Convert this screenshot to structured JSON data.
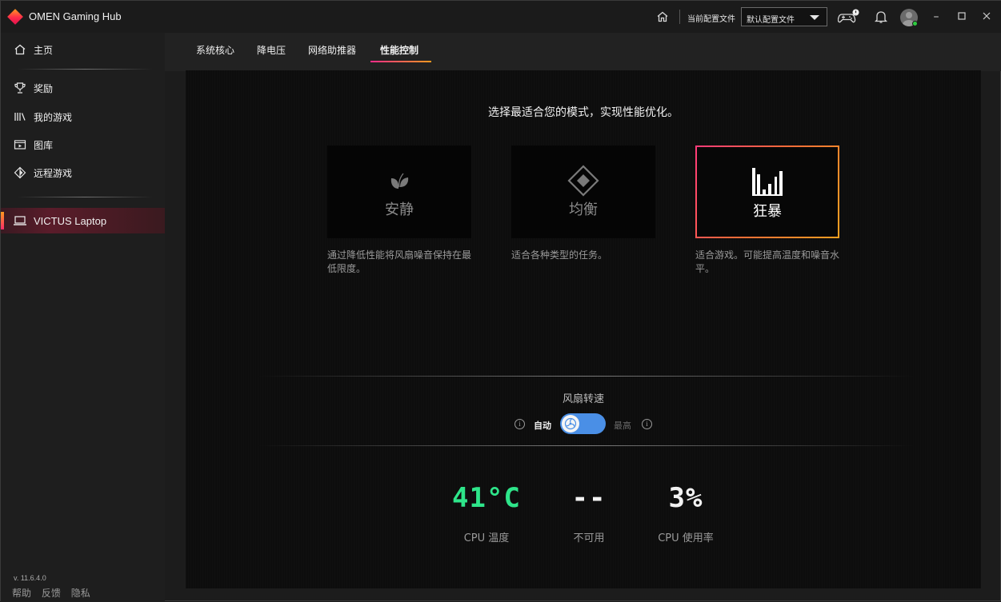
{
  "titlebar": {
    "app_title": "OMEN Gaming Hub",
    "profile_label": "当前配置文件",
    "profile_selected": "默认配置文件",
    "icons": [
      "home-icon",
      "gamepad-icon",
      "bell-icon",
      "avatar",
      "minimize-icon",
      "maximize-icon",
      "close-icon"
    ]
  },
  "sidebar": {
    "items": [
      {
        "label": "主页",
        "icon": "home-icon"
      },
      {
        "label": "奖励",
        "icon": "trophy-icon"
      },
      {
        "label": "我的游戏",
        "icon": "library-icon"
      },
      {
        "label": "图库",
        "icon": "gallery-icon"
      },
      {
        "label": "远程游戏",
        "icon": "remote-play-icon"
      }
    ],
    "device": {
      "label": "VICTUS Laptop",
      "icon": "laptop-icon"
    },
    "version": "v. 11.6.4.0",
    "footer": {
      "help": "帮助",
      "feedback": "反馈",
      "privacy": "隐私"
    }
  },
  "tabs": [
    {
      "label": "系统核心",
      "active": false
    },
    {
      "label": "降电压",
      "active": false
    },
    {
      "label": "网络助推器",
      "active": false
    },
    {
      "label": "性能控制",
      "active": true
    }
  ],
  "performance": {
    "headline": "选择最适合您的模式，实现性能优化。",
    "modes": [
      {
        "label": "安静",
        "icon": "leaf-icon",
        "description": "通过降低性能将风扇噪音保持在最低限度。",
        "selected": false
      },
      {
        "label": "均衡",
        "icon": "diamond-icon",
        "description": "适合各种类型的任务。",
        "selected": false
      },
      {
        "label": "狂暴",
        "icon": "signal-bars-icon",
        "description": "适合游戏。可能提高温度和噪音水平。",
        "selected": true
      }
    ],
    "fan": {
      "title": "风扇转速",
      "auto_label": "自动",
      "max_label": "最高",
      "mode": "auto"
    },
    "stats": [
      {
        "value": "41°C",
        "label": "CPU 温度",
        "color": "#2ee58a"
      },
      {
        "value": "--",
        "label": "不可用",
        "color": "#f2f2f2"
      },
      {
        "value": "3%",
        "label": "CPU 使用率",
        "color": "#f2f2f2"
      }
    ]
  },
  "colors": {
    "accent_gradient_start": "#ff2b8a",
    "accent_gradient_end": "#ff9a1f",
    "toggle_blue": "#4a8fe6",
    "temp_green": "#2ee58a"
  }
}
